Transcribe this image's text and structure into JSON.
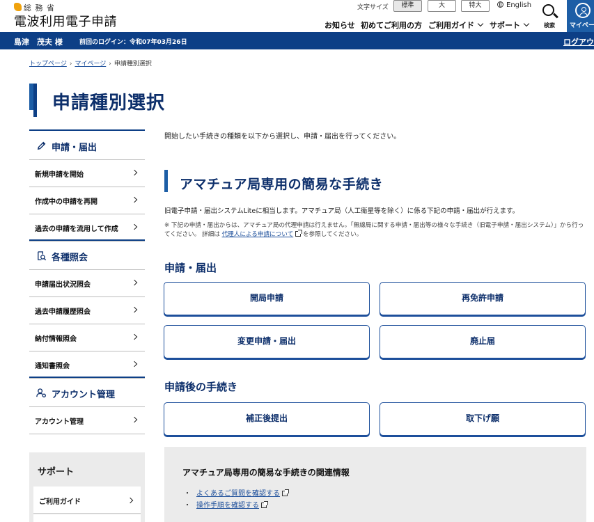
{
  "header": {
    "ministry": "総 務 省",
    "site_title": "電波利用電子申請",
    "font_size_label": "文字サイズ",
    "font_sizes": [
      "標準",
      "大",
      "特大"
    ],
    "english": "English",
    "nav": [
      "お知らせ",
      "初めてご利用の方",
      "ご利用ガイド",
      "サポート"
    ],
    "search_label": "検索",
    "mypage_label": "マイページ"
  },
  "userbar": {
    "user_name": "島津　茂夫 様",
    "last_login": "前回のログイン：令和07年03月26日",
    "logout": "ログアウ"
  },
  "breadcrumb": [
    "トップページ",
    "マイページ",
    "申請種別選択"
  ],
  "page_title": "申請種別選択",
  "sidebar": {
    "sections": [
      {
        "title": "申請・届出",
        "items": [
          "新規申請を開始",
          "作成中の申請を再開",
          "過去の申請を流用して作成"
        ]
      },
      {
        "title": "各種照会",
        "items": [
          "申請届出状況照会",
          "過去申請履歴照会",
          "納付情報照会",
          "通知書照会"
        ]
      },
      {
        "title": "アカウント管理",
        "items": [
          "アカウント管理"
        ]
      }
    ],
    "support_title": "サポート",
    "support_items": [
      "ご利用ガイド"
    ]
  },
  "main": {
    "intro": "開始したい手続きの種類を以下から選択し、申請・届出を行ってください。",
    "section_title": "アマチュア局専用の簡易な手続き",
    "description": "旧電子申請・届出システムLiteに相当します。アマチュア局（人工衛星等を除く）に係る下記の申請・届出が行えます。",
    "note_prefix": "※ 下記の申請・届出からは、アマチュア局の代理申請は行えません。「無線局に関する申請・届出等の様々な手続き（旧電子申請・届出システム）」から行ってください。 詳細は",
    "note_link": "代理人による申請について",
    "note_suffix": "を参照してください。",
    "group1_title": "申請・届出",
    "group1_buttons": [
      "開局申請",
      "再免許申請",
      "変更申請・届出",
      "廃止届"
    ],
    "group2_title": "申請後の手続き",
    "group2_buttons": [
      "補正後提出",
      "取下げ願"
    ],
    "related_title": "アマチュア局専用の簡易な手続きの関連情報",
    "related_links": [
      "よくあるご質問を確認する",
      "操作手順を確認する"
    ]
  }
}
